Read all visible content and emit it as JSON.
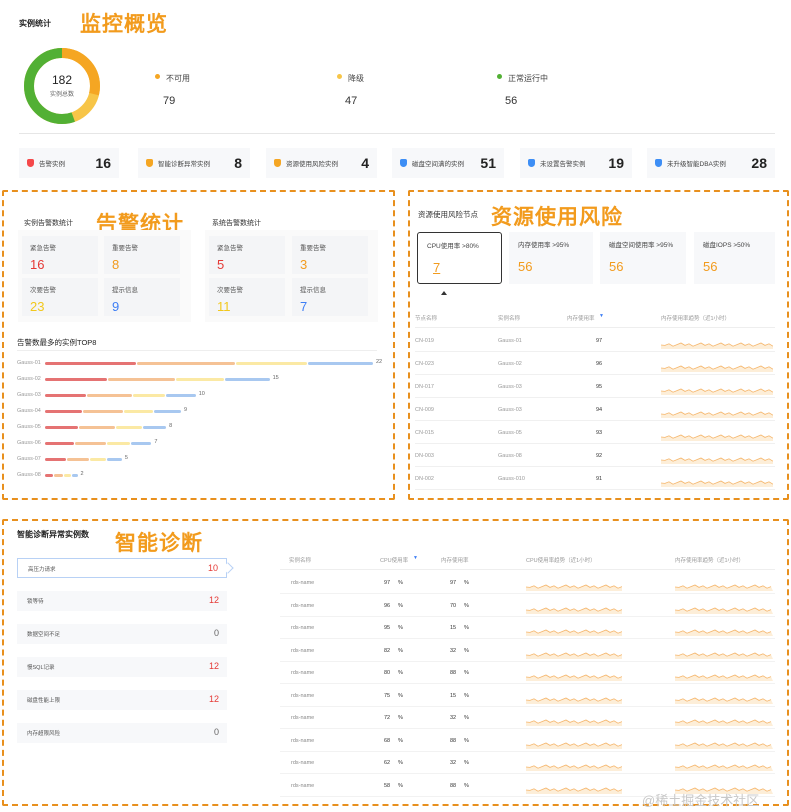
{
  "overview": {
    "section_title": "实例统计",
    "annotation": "监控概览",
    "donut_total": "182",
    "donut_label": "实例总数",
    "legend": [
      {
        "label": "不可用",
        "value": "79",
        "color": "#f5a623"
      },
      {
        "label": "降级",
        "value": "47",
        "color": "#f7c548"
      },
      {
        "label": "正常运行中",
        "value": "56",
        "color": "#52b034"
      }
    ],
    "stat_cards": [
      {
        "label": "告警实例",
        "value": "16",
        "icon": "alert-icon",
        "color": "#f5484a"
      },
      {
        "label": "智能诊断异常实例",
        "value": "8",
        "icon": "diagnosis-icon",
        "color": "#f5a623"
      },
      {
        "label": "资源使用风险实例",
        "value": "4",
        "icon": "risk-icon",
        "color": "#f5a623"
      },
      {
        "label": "磁盘空间满的实例",
        "value": "51",
        "icon": "disk-icon",
        "color": "#3d8ef5"
      },
      {
        "label": "未设置告警实例",
        "value": "19",
        "icon": "bell-off-icon",
        "color": "#3d8ef5"
      },
      {
        "label": "未升级智能DBA实例",
        "value": "28",
        "icon": "dba-icon",
        "color": "#3d8ef5"
      }
    ]
  },
  "alarms": {
    "annotation": "告警统计",
    "instance_title": "实例告警数统计",
    "system_title": "系统告警数统计",
    "instance_cards": [
      {
        "label": "紧急告警",
        "value": "16",
        "color": "#e53935"
      },
      {
        "label": "重要告警",
        "value": "8",
        "color": "#f29b1d"
      },
      {
        "label": "次要告警",
        "value": "23",
        "color": "#f2c81d"
      },
      {
        "label": "提示信息",
        "value": "9",
        "color": "#3d7ef5"
      }
    ],
    "system_cards": [
      {
        "label": "紧急告警",
        "value": "5",
        "color": "#e53935"
      },
      {
        "label": "重要告警",
        "value": "3",
        "color": "#f29b1d"
      },
      {
        "label": "次要告警",
        "value": "11",
        "color": "#f2c81d"
      },
      {
        "label": "提示信息",
        "value": "7",
        "color": "#3d7ef5"
      }
    ],
    "top_title": "告警数最多的实例TOP8",
    "top8": [
      {
        "name": "Gauss-01",
        "value": "22",
        "total": 22
      },
      {
        "name": "Gauss-02",
        "value": "15",
        "total": 15
      },
      {
        "name": "Gauss-03",
        "value": "10",
        "total": 10
      },
      {
        "name": "Gauss-04",
        "value": "9",
        "total": 9
      },
      {
        "name": "Gauss-05",
        "value": "8",
        "total": 8
      },
      {
        "name": "Gauss-06",
        "value": "7",
        "total": 7
      },
      {
        "name": "Gauss-07",
        "value": "5",
        "total": 5
      },
      {
        "name": "Gauss-08",
        "value": "2",
        "total": 2
      }
    ]
  },
  "resource": {
    "title": "资源使用风险节点",
    "annotation": "资源使用风险",
    "cards": [
      {
        "label": "CPU使用率 >80%",
        "value": "7"
      },
      {
        "label": "内存使用率 >95%",
        "value": "56"
      },
      {
        "label": "磁盘空间使用率 >95%",
        "value": "56"
      },
      {
        "label": "磁盘IOPS >50%",
        "value": "56"
      }
    ],
    "columns": [
      "节点名称",
      "实例名称",
      "内存使用率",
      "内存使用率趋势（近1小时）"
    ],
    "rows": [
      {
        "node": "CN-019",
        "instance": "Gauss-01",
        "mem": "97"
      },
      {
        "node": "CN-023",
        "instance": "Gauss-02",
        "mem": "96"
      },
      {
        "node": "DN-017",
        "instance": "Gauss-03",
        "mem": "95"
      },
      {
        "node": "CN-009",
        "instance": "Gauss-03",
        "mem": "94"
      },
      {
        "node": "CN-015",
        "instance": "Gauss-05",
        "mem": "93"
      },
      {
        "node": "DN-003",
        "instance": "Gauss-08",
        "mem": "92"
      },
      {
        "node": "DN-002",
        "instance": "Gauss-010",
        "mem": "91"
      }
    ]
  },
  "diagnosis": {
    "title": "智能诊断异常实例数",
    "annotation": "智能诊断",
    "items": [
      {
        "label": "高压力请求",
        "value": "10",
        "color": "#e53935"
      },
      {
        "label": "锁等待",
        "value": "12",
        "color": "#e53935"
      },
      {
        "label": "数据空间不足",
        "value": "0",
        "color": "#666666"
      },
      {
        "label": "慢SQL记录",
        "value": "12",
        "color": "#e53935"
      },
      {
        "label": "磁盘性能上限",
        "value": "12",
        "color": "#e53935"
      },
      {
        "label": "内存超限风险",
        "value": "0",
        "color": "#666666"
      }
    ],
    "columns": [
      "实例名称",
      "CPU使用率",
      "内存使用率",
      "CPU使用率趋势（近1小时）",
      "内存使用率趋势（近1小时）"
    ],
    "rows": [
      {
        "name": "rds-name",
        "cpu": "97",
        "mem": "97"
      },
      {
        "name": "rds-name",
        "cpu": "96",
        "mem": "70"
      },
      {
        "name": "rds-name",
        "cpu": "95",
        "mem": "15"
      },
      {
        "name": "rds-name",
        "cpu": "82",
        "mem": "32"
      },
      {
        "name": "rds-name",
        "cpu": "80",
        "mem": "88"
      },
      {
        "name": "rds-name",
        "cpu": "75",
        "mem": "15"
      },
      {
        "name": "rds-name",
        "cpu": "72",
        "mem": "32"
      },
      {
        "name": "rds-name",
        "cpu": "68",
        "mem": "88"
      },
      {
        "name": "rds-name",
        "cpu": "62",
        "mem": "32"
      },
      {
        "name": "rds-name",
        "cpu": "58",
        "mem": "88"
      }
    ],
    "percent": "%"
  },
  "watermark": "@稀土掘金技术社区"
}
